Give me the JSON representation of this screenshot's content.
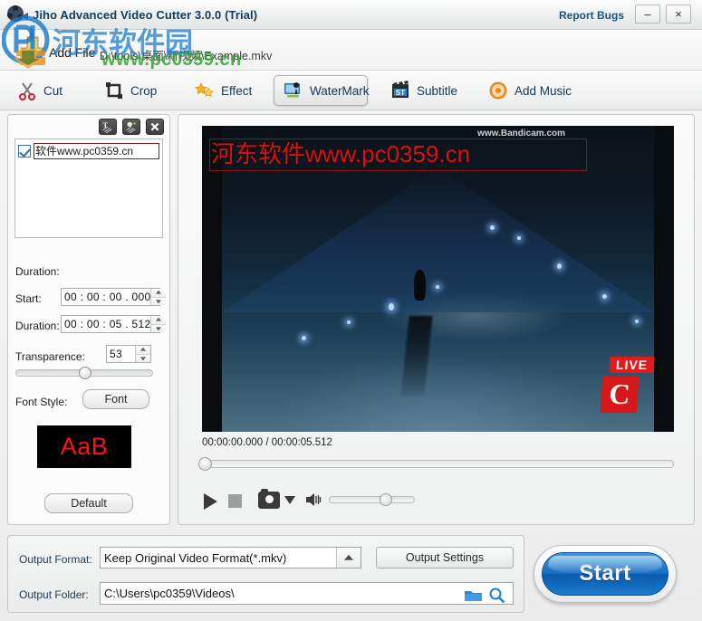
{
  "window": {
    "title": "Jiho Advanced Video Cutter 3.0.0 (Trial)",
    "report_bugs": "Report Bugs",
    "minimize": "–",
    "close": "×"
  },
  "addfile": {
    "label": "Add File",
    "path": "D:\\tools\\桌面\\新视频\\Example.mkv"
  },
  "tabs": [
    {
      "label": "Cut",
      "icon": "scissors-icon",
      "active": false
    },
    {
      "label": "Crop",
      "icon": "crop-icon",
      "active": false
    },
    {
      "label": "Effect",
      "icon": "stars-icon",
      "active": false
    },
    {
      "label": "WaterMark",
      "icon": "watermark-icon",
      "active": true
    },
    {
      "label": "Subtitle",
      "icon": "subtitle-icon",
      "active": false
    },
    {
      "label": "Add Music",
      "icon": "music-icon",
      "active": false
    }
  ],
  "watermark_panel": {
    "tools": [
      {
        "name": "add-text-watermark",
        "glyph": "T"
      },
      {
        "name": "add-image-watermark",
        "glyph": "◆"
      },
      {
        "name": "delete-watermark",
        "glyph": "✕"
      }
    ],
    "list": [
      {
        "checked": true,
        "text": "软件www.pc0359.cn"
      }
    ],
    "duration_label": "Duration:",
    "start_label": "Start:",
    "start_value": "00 : 00 : 00 . 000",
    "duration_field_label": "Duration:",
    "duration_value": "00 : 00 : 05 . 512",
    "transparence_label": "Transparence:",
    "transparence_value": "53",
    "font_style_label": "Font Style:",
    "font_button": "Font",
    "font_preview_text": "AaB",
    "font_preview_color": "#ff1111",
    "default_button": "Default"
  },
  "preview": {
    "watermark_text": "河东软件www.pc0359.cn",
    "watermark_color": "#dd1010",
    "recorder_tag": "www.Bandicam.com",
    "live_badge": "LIVE",
    "channel_logo": "C",
    "time_display": "00:00:00.000 / 00:00:05.512",
    "controls": [
      {
        "name": "play-button",
        "label": "Play"
      },
      {
        "name": "stop-button",
        "label": "Stop"
      },
      {
        "name": "snapshot-button",
        "label": "Snapshot"
      },
      {
        "name": "snapshot-dropdown",
        "label": "Snapshot options"
      },
      {
        "name": "volume-icon",
        "label": "Volume"
      }
    ]
  },
  "output": {
    "format_label": "Output Format:",
    "format_value": "Keep Original Video Format(*.mkv)",
    "settings_button": "Output Settings",
    "folder_label": "Output Folder:",
    "folder_value": "C:\\Users\\pc0359\\Videos\\"
  },
  "start_button": {
    "label": "Start"
  },
  "site_watermark": {
    "name_cn": "河东软件园",
    "url": "www.pc0359.cn"
  }
}
